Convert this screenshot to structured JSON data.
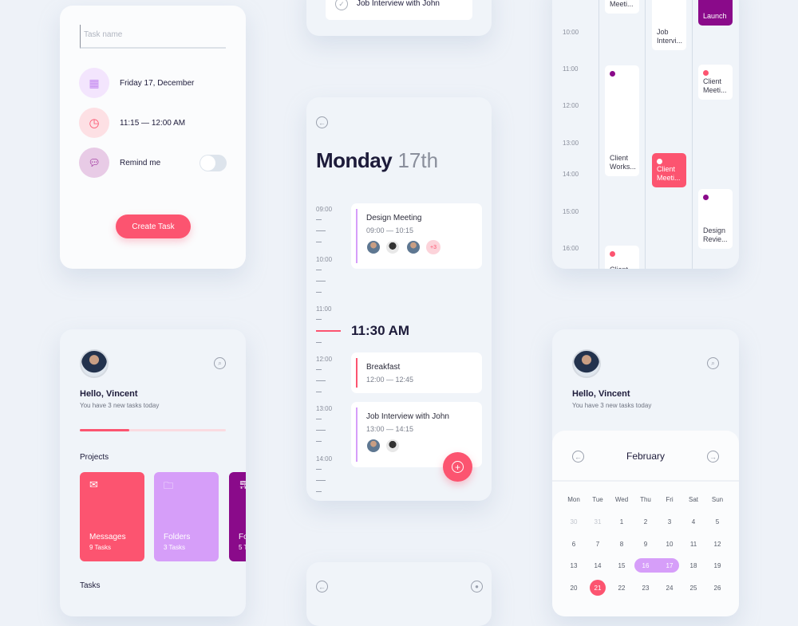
{
  "create_task": {
    "task_name_placeholder": "Task name",
    "date": "Friday 17, December",
    "time": "11:15 — 12:00 AM",
    "remind_label": "Remind me",
    "remind_on": false,
    "button": "Create Task"
  },
  "top_middle": {
    "task": "Job Interview with John"
  },
  "day_view": {
    "day": "Monday",
    "date": "17th",
    "now": "11:30 AM",
    "hours": [
      "09:00",
      "10:00",
      "11:00",
      "12:00",
      "13:00",
      "14:00"
    ],
    "events": [
      {
        "title": "Design Meeting",
        "time": "09:00 — 10:15",
        "color": "#d69ef9",
        "extra": "+3"
      },
      {
        "title": "Breakfast",
        "time": "12:00 — 12:45",
        "color": "#fc5470"
      },
      {
        "title": "Job Interview with John",
        "time": "13:00 — 14:15",
        "color": "#d69ef9"
      }
    ]
  },
  "week_view": {
    "hours": [
      "10:00",
      "11:00",
      "12:00",
      "13:00",
      "14:00",
      "15:00",
      "16:00"
    ],
    "events": [
      {
        "label": "Meeti...",
        "col": 0
      },
      {
        "label": "Client Works...",
        "col": 0,
        "dot": "#8a0a8a"
      },
      {
        "label": "Client",
        "col": 0,
        "dot": "#fc5470"
      },
      {
        "label": "Job Intervi...",
        "col": 1
      },
      {
        "label": "Client Meeti...",
        "col": 1,
        "fill": "#fc5470"
      },
      {
        "label": "Launch",
        "col": 2,
        "fill": "#8a0a8a"
      },
      {
        "label": "Client Meeti...",
        "col": 2,
        "dot": "#fc5470"
      },
      {
        "label": "Design Revie...",
        "col": 2,
        "dot": "#8a0a8a"
      }
    ]
  },
  "home": {
    "greeting": "Hello, Vincent",
    "subtitle": "You have 3 new tasks today",
    "progress": 0.34,
    "projects_label": "Projects",
    "tasks_label": "Tasks",
    "projects": [
      {
        "name": "Messages",
        "count": "9 Tasks",
        "color": "#fc5470"
      },
      {
        "name": "Folders",
        "count": "3 Tasks",
        "color": "#d69ef9"
      },
      {
        "name": "Fo",
        "count": "5 T",
        "color": "#8a0a8a"
      }
    ]
  },
  "calendar": {
    "greeting": "Hello, Vincent",
    "subtitle": "You have 3 new tasks today",
    "month": "February",
    "weekdays": [
      "Mon",
      "Tue",
      "Wed",
      "Thu",
      "Fri",
      "Sat",
      "Sun"
    ],
    "days": [
      [
        "30",
        "31",
        "1",
        "2",
        "3",
        "4",
        "5"
      ],
      [
        "6",
        "7",
        "8",
        "9",
        "10",
        "11",
        "12"
      ],
      [
        "13",
        "14",
        "15",
        "16",
        "17",
        "18",
        "19"
      ],
      [
        "20",
        "21",
        "22",
        "23",
        "24",
        "25",
        "26"
      ]
    ],
    "range_selected": [
      "16",
      "17"
    ],
    "today": "21"
  },
  "colors": {
    "accent": "#fc5470",
    "lilac": "#d69ef9",
    "purple": "#8a0a8a"
  }
}
